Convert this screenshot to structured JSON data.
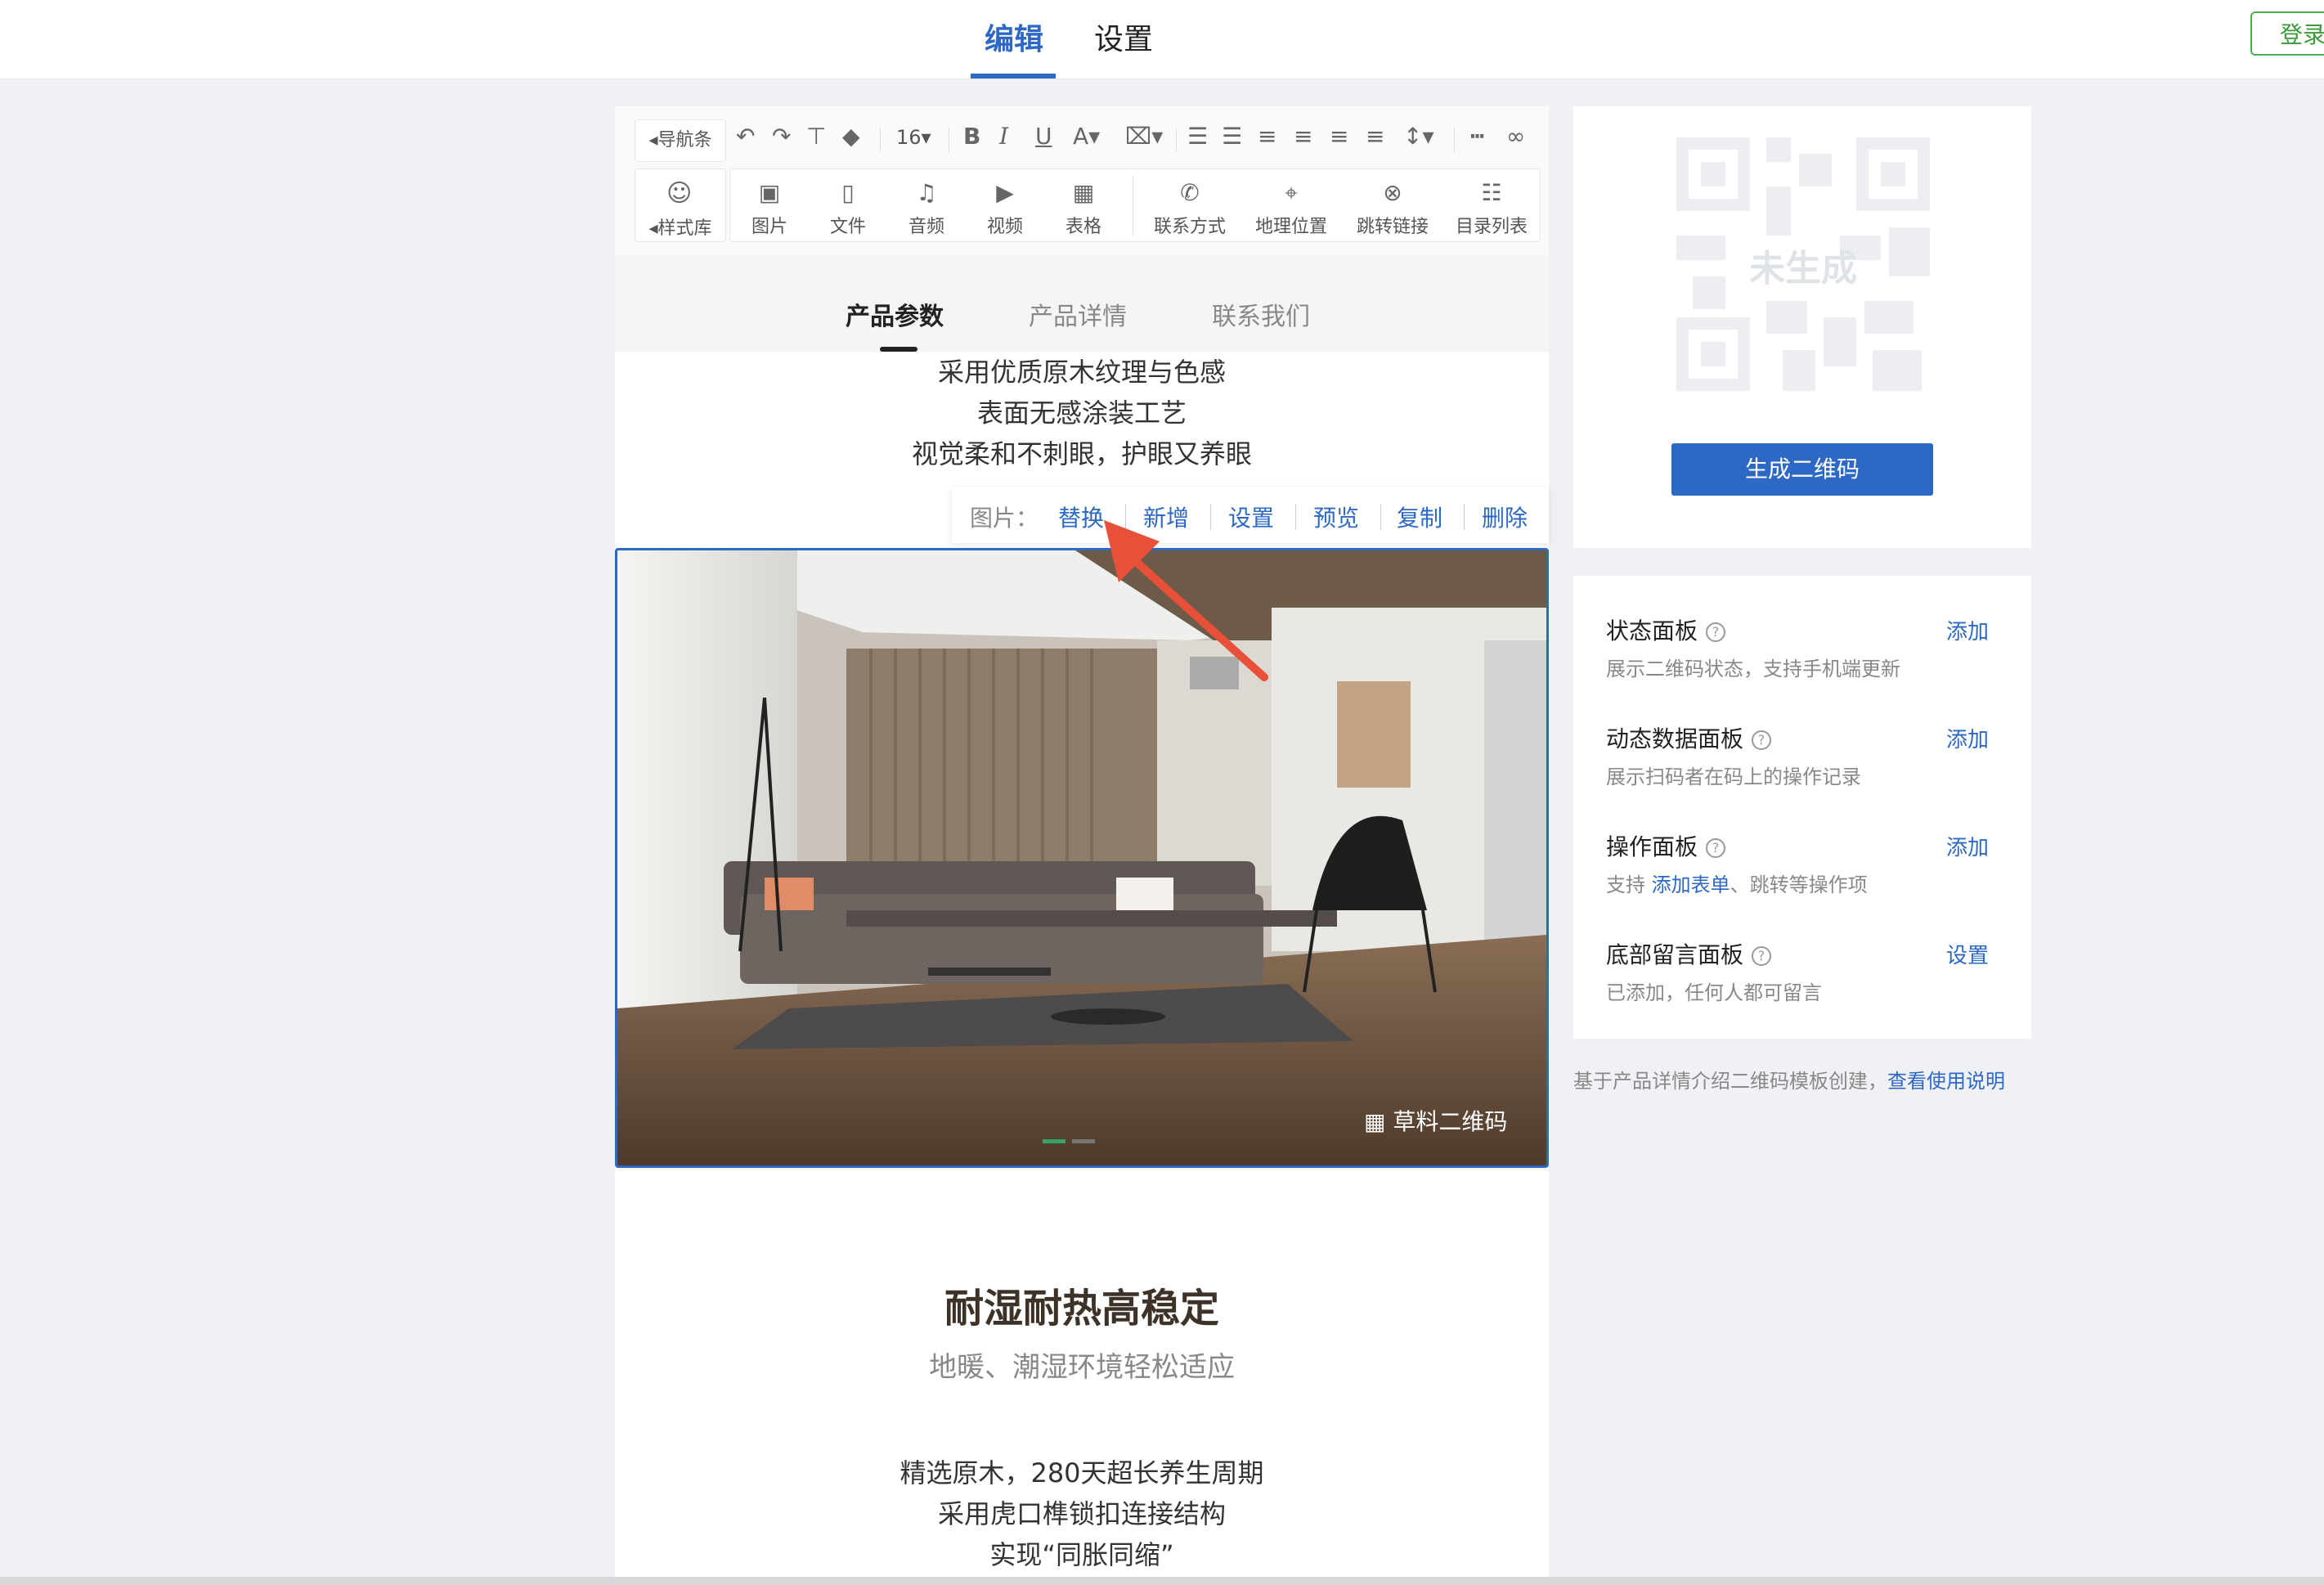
{
  "topnav": {
    "tabs": [
      {
        "label": "编辑"
      },
      {
        "label": "设置"
      }
    ],
    "login": "登录"
  },
  "toolbar": {
    "nav_bar": "◂导航条",
    "font_size": "16",
    "style_lib": "◂样式库",
    "insert_items": [
      "图片",
      "文件",
      "音频",
      "视频",
      "表格",
      "联系方式",
      "地理位置",
      "跳转链接",
      "目录列表"
    ]
  },
  "content_tabs": [
    "产品参数",
    "产品详情",
    "联系我们"
  ],
  "intro_lines": [
    "采用优质原木纹理与色感",
    "表面无感涂装工艺",
    "视觉柔和不刺眼，护眼又养眼"
  ],
  "image_toolbar": {
    "label": "图片：",
    "actions": [
      "替换",
      "新增",
      "设置",
      "预览",
      "复制",
      "删除"
    ]
  },
  "photo_watermark": "草料二维码",
  "section2": {
    "heading": "耐湿耐热高稳定",
    "subheading": "地暖、潮湿环境轻松适应",
    "lines": [
      "精选原木，280天超长养生周期",
      "采用虎口榫锁扣连接结构",
      "实现“同胀同缩”"
    ]
  },
  "qr": {
    "placeholder": "未生成",
    "generate": "生成二维码"
  },
  "panels": [
    {
      "title": "状态面板",
      "desc": "展示二维码状态，支持手机端更新",
      "action": "添加"
    },
    {
      "title": "动态数据面板",
      "desc": "展示扫码者在码上的操作记录",
      "action": "添加"
    },
    {
      "title": "操作面板",
      "desc_prefix": "支持 ",
      "desc_link": "添加表单",
      "desc_suffix": "、跳转等操作项",
      "action": "添加"
    },
    {
      "title": "底部留言面板",
      "desc": "已添加，任何人都可留言",
      "action": "设置"
    }
  ],
  "footer_note": {
    "text": "基于产品详情介绍二维码模板创建，",
    "link": "查看使用说明"
  },
  "colors": {
    "accent": "#2d68c4",
    "login_green": "#3a9a3a",
    "annotation_arrow": "#e8503a"
  }
}
